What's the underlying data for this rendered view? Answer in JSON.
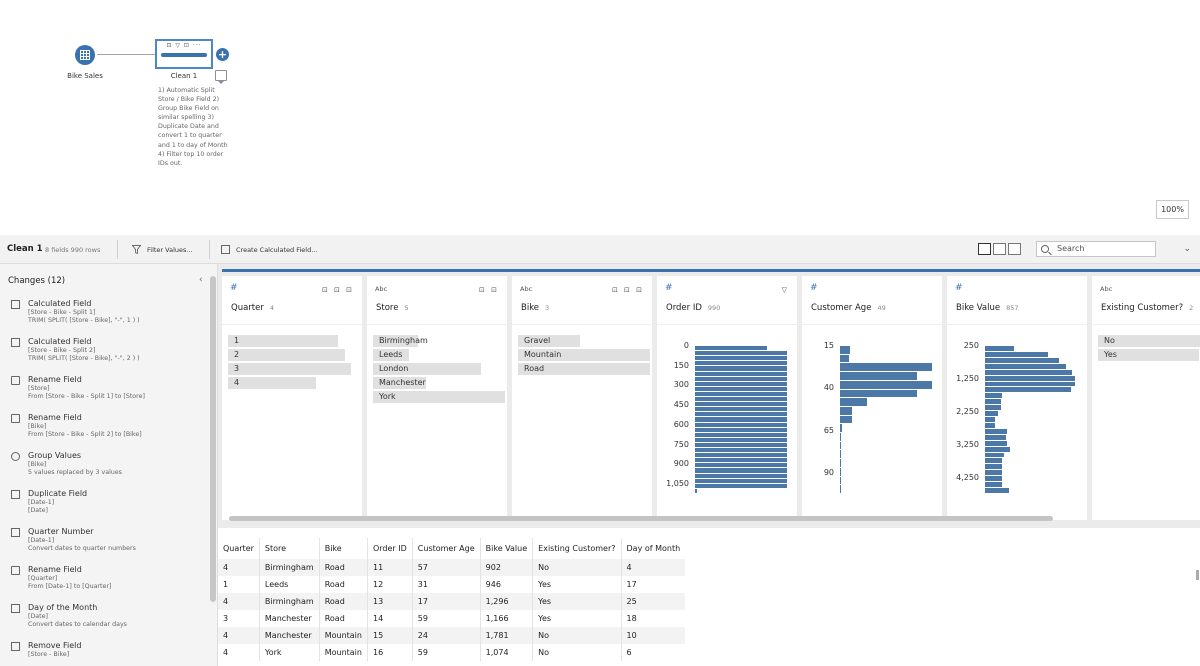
{
  "flow": {
    "input_node_label": "Bike Sales",
    "clean_node_label": "Clean 1",
    "clean_node_icons": "⊡ ▽ ⊡ ···",
    "add_step_label": "+",
    "step_note": "1) Automatic Split Store / Bike Field 2) Group Bike Field on similar spelling 3) Duplicate Date and convert 1 to quarter and 1 to day of Month 4) Filter top 10 order IDs out.",
    "zoom": "100%"
  },
  "toolbar": {
    "title": "Clean 1",
    "subtitle": "8 fields  990 rows",
    "filter_label": "Filter Values...",
    "calc_label": "Create Calculated Field...",
    "search_placeholder": "Search"
  },
  "changes": {
    "title": "Changes (12)",
    "collapse": "‹",
    "items": [
      {
        "name": "Calculated Field",
        "line1": "[Store - Bike - Split 1]",
        "line2": "TRIM( SPLIT( [Store - Bike], \"-\", 1 ) )",
        "icon": "calc-icon"
      },
      {
        "name": "Calculated Field",
        "line1": "[Store - Bike - Split 2]",
        "line2": "TRIM( SPLIT( [Store - Bike], \"-\", 2 ) )",
        "icon": "calc-icon"
      },
      {
        "name": "Rename Field",
        "line1": "[Store]",
        "line2": "From [Store - Bike - Split 1] to [Store]",
        "icon": "rename-icon"
      },
      {
        "name": "Rename Field",
        "line1": "[Bike]",
        "line2": "From [Store - Bike - Split 2] to [Bike]",
        "icon": "rename-icon"
      },
      {
        "name": "Group Values",
        "line1": "[Bike]",
        "line2": "5 values replaced by 3 values",
        "icon": "group-icon"
      },
      {
        "name": "Duplicate Field",
        "line1": "[Date-1]",
        "line2": "[Date]",
        "icon": "duplicate-icon"
      },
      {
        "name": "Quarter Number",
        "line1": "[Date-1]",
        "line2": "Convert dates to quarter numbers",
        "icon": "calc-icon"
      },
      {
        "name": "Rename Field",
        "line1": "[Quarter]",
        "line2": "From [Date-1] to [Quarter]",
        "icon": "rename-icon"
      },
      {
        "name": "Day of the Month",
        "line1": "[Date]",
        "line2": "Convert dates to calendar days",
        "icon": "calc-icon"
      },
      {
        "name": "Remove Field",
        "line1": "[Store - Bike]",
        "line2": "",
        "icon": "calc-icon"
      }
    ]
  },
  "profile": {
    "cards": [
      {
        "type": "#",
        "name": "Quarter",
        "count": "4",
        "icons": "⊡ ⊡ ⊡",
        "values": [
          {
            "label": "1",
            "frac": 0.83
          },
          {
            "label": "2",
            "frac": 0.89
          },
          {
            "label": "3",
            "frac": 0.93
          },
          {
            "label": "4",
            "frac": 0.67
          }
        ]
      },
      {
        "type": "Abc",
        "name": "Store",
        "count": "5",
        "icons": "⊡ ⊡",
        "values": [
          {
            "label": "Birmingham",
            "frac": 0.34
          },
          {
            "label": "Leeds",
            "frac": 0.27
          },
          {
            "label": "London",
            "frac": 0.82
          },
          {
            "label": "Manchester",
            "frac": 0.4
          },
          {
            "label": "York",
            "frac": 1.0
          }
        ]
      },
      {
        "type": "Abc",
        "name": "Bike",
        "count": "3",
        "icons": "⊡ ⊡ ⊡",
        "values": [
          {
            "label": "Gravel",
            "frac": 0.47
          },
          {
            "label": "Mountain",
            "frac": 1.0
          },
          {
            "label": "Road",
            "frac": 1.0
          }
        ]
      },
      {
        "type": "#",
        "name": "Order ID",
        "count": "990",
        "icons": "▽",
        "ticks": [
          "0",
          "150",
          "300",
          "450",
          "600",
          "750",
          "900",
          "1,050"
        ],
        "bins": [
          0.78,
          1,
          1,
          1,
          1,
          1,
          1,
          1,
          1,
          1,
          1,
          1,
          1,
          1,
          1,
          1,
          1,
          1,
          1,
          1,
          1,
          1,
          1,
          1,
          1,
          1,
          1,
          1,
          0.02
        ]
      },
      {
        "type": "#",
        "name": "Customer Age",
        "count": "49",
        "icons": "",
        "ticks": [
          "15",
          "40",
          "65",
          "90"
        ],
        "bins": [
          0.11,
          0.1,
          1.0,
          0.84,
          1.0,
          0.84,
          0.29,
          0.13,
          0.13,
          0.02,
          0.01,
          0.01,
          0.01,
          0.01,
          0.01,
          0.01,
          0.01
        ]
      },
      {
        "type": "#",
        "name": "Bike Value",
        "count": "857",
        "icons": "",
        "ticks": [
          "250",
          "1,250",
          "2,250",
          "3,250",
          "4,250"
        ],
        "bins": [
          0.32,
          0.68,
          0.8,
          0.88,
          0.95,
          0.98,
          0.98,
          0.93,
          0.19,
          0.17,
          0.17,
          0.14,
          0.11,
          0.11,
          0.24,
          0.23,
          0.24,
          0.27,
          0.21,
          0.19,
          0.19,
          0.19,
          0.19,
          0.19,
          0.26
        ]
      },
      {
        "type": "Abc",
        "name": "Existing Customer?",
        "count": "2",
        "icons": "",
        "values": [
          {
            "label": "No",
            "frac": 1.0
          },
          {
            "label": "Yes",
            "frac": 0.9
          }
        ]
      }
    ]
  },
  "grid": {
    "columns": [
      "Quarter",
      "Store",
      "Bike",
      "Order ID",
      "Customer Age",
      "Bike Value",
      "Existing Customer?",
      "Day of Month"
    ],
    "rows": [
      [
        "4",
        "Birmingham",
        "Road",
        "11",
        "57",
        "902",
        "No",
        "4"
      ],
      [
        "1",
        "Leeds",
        "Road",
        "12",
        "31",
        "946",
        "Yes",
        "17"
      ],
      [
        "4",
        "Birmingham",
        "Road",
        "13",
        "17",
        "1,296",
        "Yes",
        "25"
      ],
      [
        "3",
        "Manchester",
        "Road",
        "14",
        "59",
        "1,166",
        "Yes",
        "18"
      ],
      [
        "4",
        "Manchester",
        "Mountain",
        "15",
        "24",
        "1,781",
        "No",
        "10"
      ],
      [
        "4",
        "York",
        "Mountain",
        "16",
        "59",
        "1,074",
        "No",
        "6"
      ]
    ]
  },
  "colors": {
    "accent": "#3a72b0",
    "bar": "#4c78a8",
    "category_fill": "#e0e0e0"
  }
}
